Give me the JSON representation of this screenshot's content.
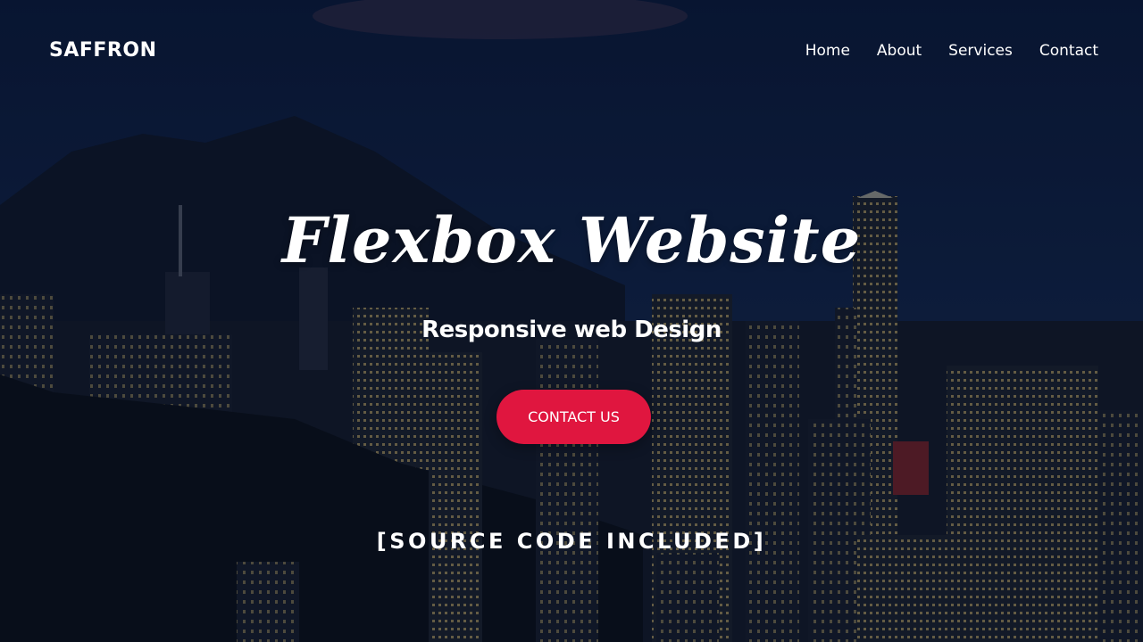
{
  "brand": {
    "logo_text": "SAFFRON"
  },
  "nav": {
    "links": [
      {
        "label": "Home"
      },
      {
        "label": "About"
      },
      {
        "label": "Services"
      },
      {
        "label": "Contact"
      }
    ]
  },
  "hero": {
    "title": "Flexbox Website",
    "subtitle": "Responsive web Design",
    "cta_label": "CONTACT US",
    "cta_color": "#e0163f"
  },
  "banner": {
    "text": "[SOURCE CODE INCLUDED]"
  },
  "background": {
    "description_icon": "city-skyline-night-image"
  }
}
